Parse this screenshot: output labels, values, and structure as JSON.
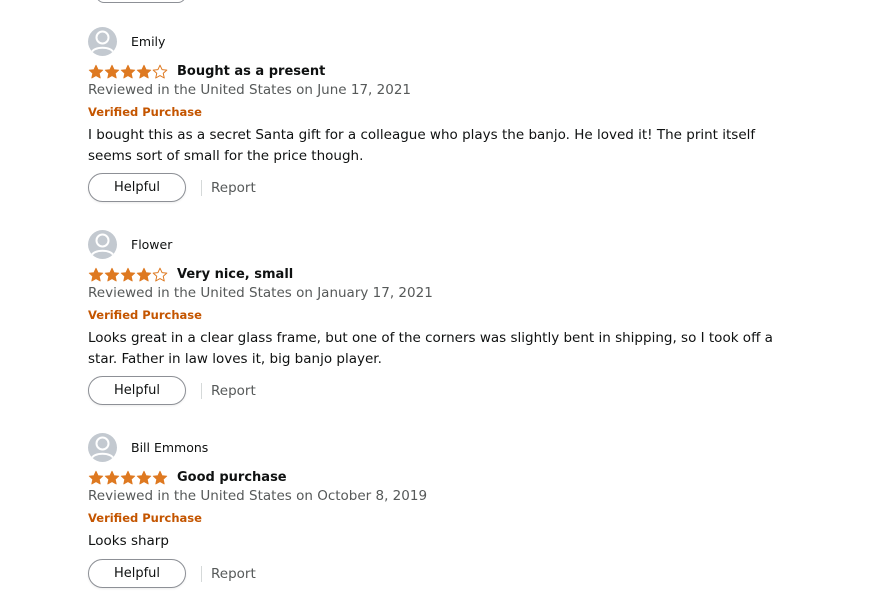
{
  "reviews": [
    {
      "author": "Emily",
      "rating": 4,
      "rating_max": 5,
      "title": "Bought as a present",
      "date": "Reviewed in the United States on June 17, 2021",
      "verified": "Verified Purchase",
      "body": "I bought this as a secret Santa gift for a colleague who plays the banjo. He loved it! The print itself seems sort of small for the price though.",
      "helpful_label": "Helpful",
      "report_label": "Report"
    },
    {
      "author": "Flower",
      "rating": 4,
      "rating_max": 5,
      "title": "Very nice, small",
      "date": "Reviewed in the United States on January 17, 2021",
      "verified": "Verified Purchase",
      "body": "Looks great in a clear glass frame, but one of the corners was slightly bent in shipping, so I took off a star. Father in law loves it, big banjo player.",
      "helpful_label": "Helpful",
      "report_label": "Report"
    },
    {
      "author": "Bill Emmons",
      "rating": 5,
      "rating_max": 5,
      "title": "Good purchase",
      "date": "Reviewed in the United States on October 8, 2019",
      "verified": "Verified Purchase",
      "body": "Looks sharp",
      "helpful_label": "Helpful",
      "report_label": "Report"
    }
  ],
  "colors": {
    "star": "#de7921",
    "verified": "#c45500",
    "muted_text": "#565959",
    "avatar_bg": "#c3c9d0"
  },
  "icons": {
    "avatar": "default-profile-icon",
    "star_filled": "star-filled-icon",
    "star_empty": "star-empty-icon"
  }
}
